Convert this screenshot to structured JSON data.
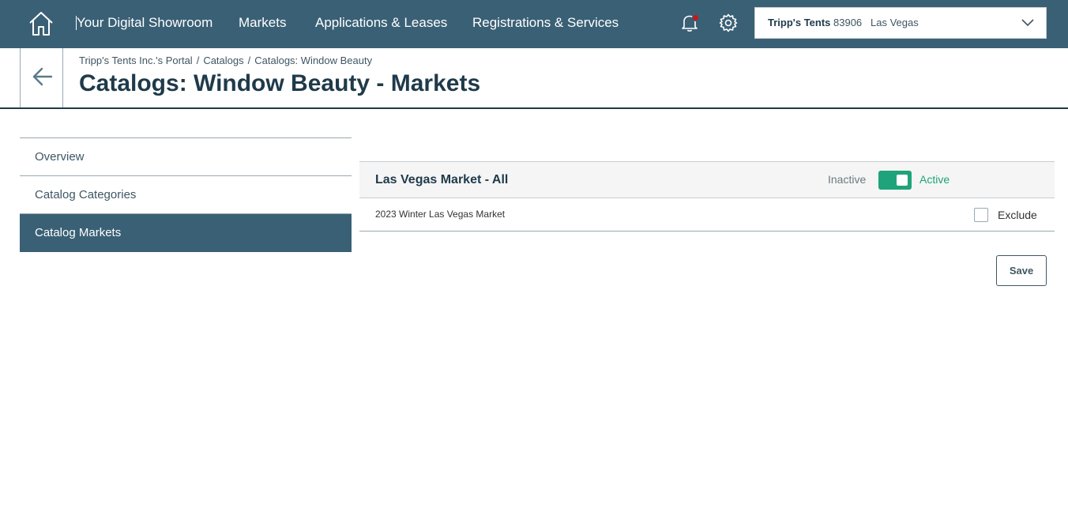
{
  "nav": {
    "items": [
      {
        "label": "Your Digital Showroom"
      },
      {
        "label": "Markets"
      },
      {
        "label": "Applications & Leases"
      },
      {
        "label": "Registrations & Services"
      }
    ],
    "icons": {
      "home": "home-icon",
      "bell": "bell-icon",
      "gear": "gear-icon"
    },
    "notification_dot": true,
    "account": {
      "name": "Tripp's Tents",
      "number": "83906",
      "location": "Las Vegas"
    }
  },
  "header": {
    "breadcrumb": [
      "Tripp's Tents Inc.'s Portal",
      "Catalogs",
      "Catalogs: Window Beauty"
    ],
    "breadcrumb_sep": "/",
    "title": "Catalogs: Window Beauty - Markets"
  },
  "sidebar": {
    "items": [
      {
        "label": "Overview",
        "active": false
      },
      {
        "label": "Catalog Categories",
        "active": false
      },
      {
        "label": "Catalog Markets",
        "active": true
      }
    ]
  },
  "market": {
    "title": "Las Vegas Market - All",
    "inactive_label": "Inactive",
    "active_label": "Active",
    "is_active": true,
    "rows": [
      {
        "name": "2023 Winter Las Vegas Market",
        "exclude_label": "Exclude",
        "excluded": false
      }
    ]
  },
  "actions": {
    "save_label": "Save"
  },
  "colors": {
    "nav_bg": "#3a6075",
    "title": "#1f3a4a",
    "toggle_on": "#1fa37a",
    "notification": "#c41a1a"
  }
}
